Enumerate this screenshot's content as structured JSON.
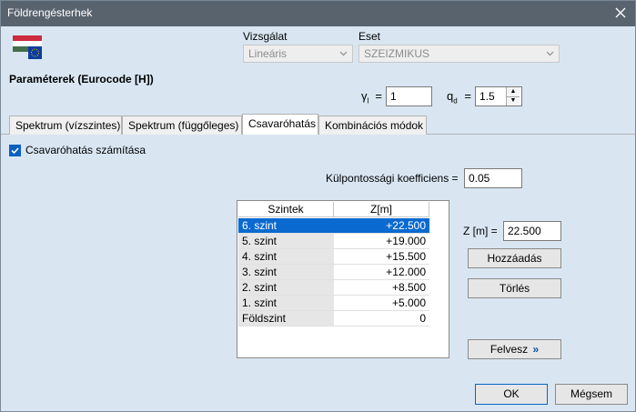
{
  "window": {
    "title": "Földrengésterhek"
  },
  "icons": {
    "flag": "hungarian-eu-flag-icon",
    "close": "close-icon"
  },
  "header": {
    "vizsgalat_label": "Vizsgálat",
    "vizsgalat_value": "Lineáris",
    "eset_label": "Eset",
    "eset_value": "SZEIZMIKUS",
    "params_title": "Paraméterek (Eurocode [H])",
    "gamma_symbol": "γ",
    "gamma_sub": "I",
    "gamma_eq": "=",
    "gamma_value": "1",
    "q_symbol": "q",
    "q_sub": "d",
    "q_eq": "=",
    "q_value": "1.5"
  },
  "tabs": [
    {
      "label": "Spektrum (vízszintes)"
    },
    {
      "label": "Spektrum (függőleges)"
    },
    {
      "label": "Csavaróhatás"
    },
    {
      "label": "Kombinációs módok"
    }
  ],
  "torsion": {
    "checkbox_label": "Csavaróhatás számítása",
    "checked": true,
    "ecc_label": "Külpontossági koefficiens =",
    "ecc_value": "0.05"
  },
  "table": {
    "headers": [
      "Szintek",
      "Z[m]"
    ],
    "rows": [
      {
        "level": "6. szint",
        "z": "+22.500",
        "selected": true
      },
      {
        "level": "5. szint",
        "z": "+19.000"
      },
      {
        "level": "4. szint",
        "z": "+15.500"
      },
      {
        "level": "3. szint",
        "z": "+12.000"
      },
      {
        "level": "2. szint",
        "z": "+8.500"
      },
      {
        "level": "1. szint",
        "z": "+5.000"
      },
      {
        "level": "Földszint",
        "z": "0"
      }
    ]
  },
  "side": {
    "z_label": "Z [m] =",
    "z_value": "22.500",
    "add_button": "Hozzáadás",
    "delete_button": "Törlés",
    "pickup_button": "Felvesz",
    "pickup_arrow": "»"
  },
  "footer": {
    "ok": "OK",
    "cancel": "Mégsem"
  },
  "colors": {
    "accent": "#0a6acf",
    "dialog_bg": "#d9e6f2",
    "titlebar": "#59636e"
  }
}
